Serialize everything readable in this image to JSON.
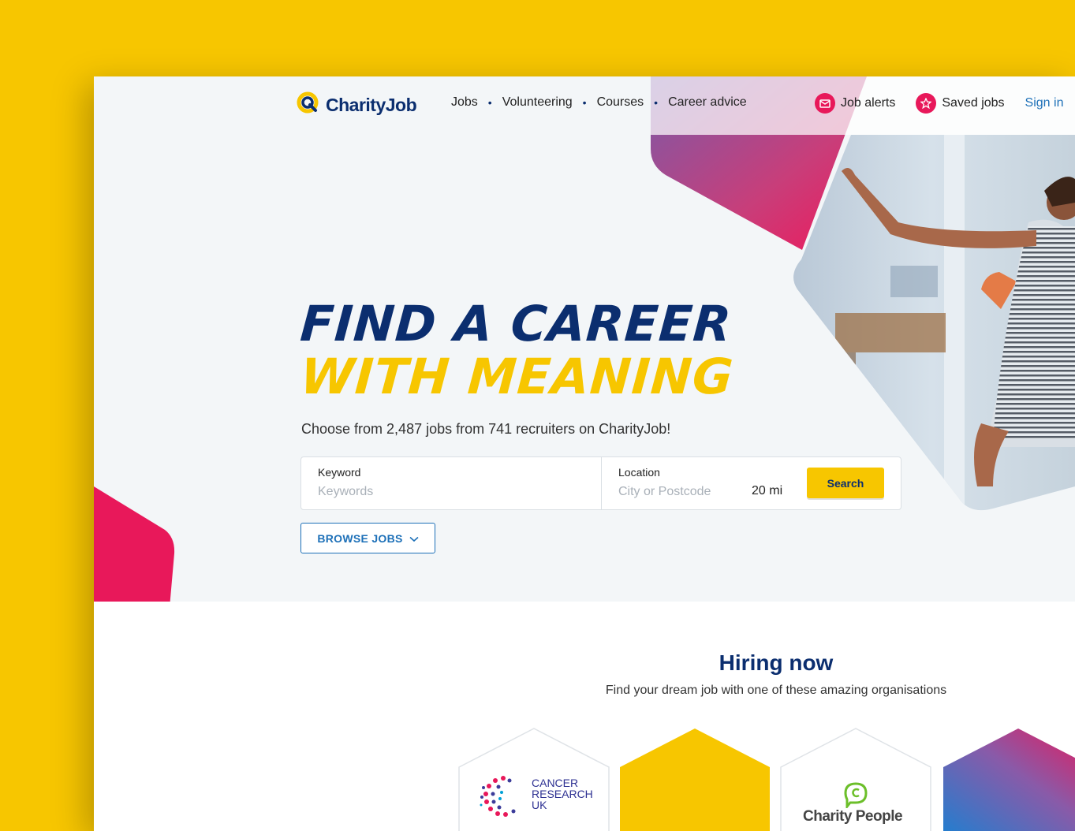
{
  "nav": {
    "logo_text": "CharityJob",
    "links": [
      "Jobs",
      "Volunteering",
      "Courses",
      "Career advice"
    ],
    "job_alerts": "Job alerts",
    "saved_jobs": "Saved jobs",
    "sign_in": "Sign in"
  },
  "hero": {
    "headline_line1": "FIND A CAREER",
    "headline_line2": "WITH MEANING",
    "subline": "Choose from 2,487 jobs from 741 recruiters on CharityJob!"
  },
  "search": {
    "keyword_label": "Keyword",
    "keyword_placeholder": "Keywords",
    "location_label": "Location",
    "location_placeholder": "City or Postcode",
    "radius": "20 mi",
    "button": "Search"
  },
  "browse": {
    "label": "BROWSE JOBS"
  },
  "hiring": {
    "title": "Hiring now",
    "subtitle": "Find your dream job with one of these amazing organisations",
    "organisations": [
      {
        "name_line1": "CANCER",
        "name_line2": "RESEARCH",
        "name_line3": "UK"
      },
      {
        "name": ""
      },
      {
        "name": "Charity People"
      },
      {
        "name": ""
      }
    ]
  },
  "colors": {
    "brand_navy": "#0b2e6f",
    "brand_yellow": "#f7c600",
    "brand_pink": "#e8185a",
    "link_blue": "#1d70b8",
    "backdrop": "#f7c600"
  },
  "icons": {
    "logo": "magnifier-logo-icon",
    "job_alerts": "envelope-icon",
    "saved_jobs": "star-icon",
    "browse": "chevron-down-icon"
  }
}
